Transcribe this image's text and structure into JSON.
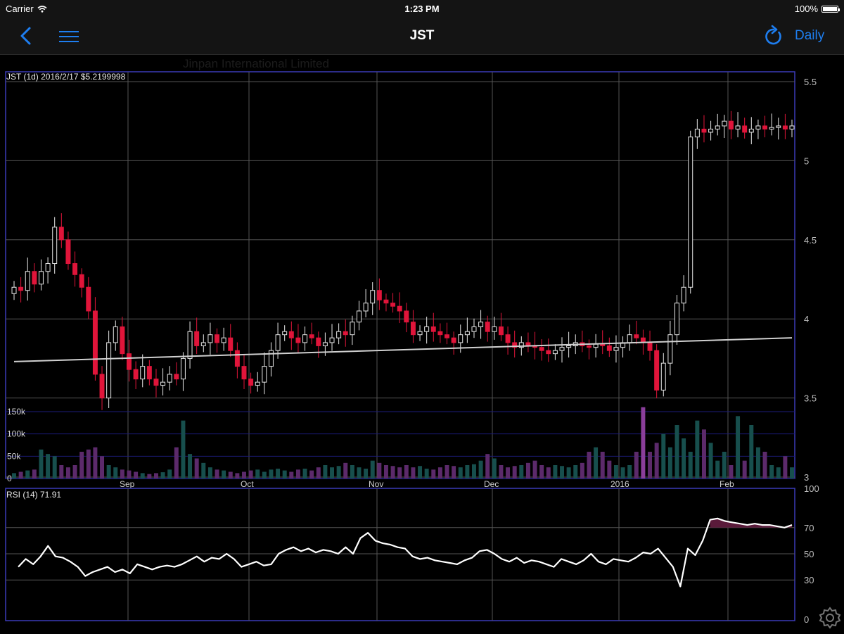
{
  "status_bar": {
    "carrier": "Carrier",
    "time": "1:23 PM",
    "battery": "100%"
  },
  "nav": {
    "title": "JST",
    "period_label": "Daily",
    "icons": {
      "back": "chevron-left-icon",
      "menu": "hamburger-menu-icon",
      "refresh": "refresh-icon",
      "settings": "gear-icon"
    },
    "accent_color": "#1e7ef0"
  },
  "chart_data": [
    {
      "type": "candlestick",
      "watermark": "Jinpan International Limited",
      "info_label": "JST (1d) 2016/2/17 $5.2199998",
      "ylim": [
        3,
        5.5
      ],
      "yticks": [
        "3",
        "3.5",
        "4",
        "4.5",
        "5",
        "5.5"
      ],
      "x_tick_labels": [
        "Sep",
        "Oct",
        "Nov",
        "Dec",
        "2016",
        "Feb"
      ],
      "colors": {
        "up": "#e8e8e8",
        "down": "#e0153a",
        "grid": "#555555",
        "axis": "#3a3ab8",
        "moving_average": "#d0d0d0"
      },
      "moving_average": [
        3.73,
        3.88
      ],
      "closes": [
        4.2,
        4.18,
        4.3,
        4.22,
        4.3,
        4.35,
        4.58,
        4.5,
        4.35,
        4.28,
        4.2,
        4.05,
        3.65,
        3.5,
        3.85,
        3.95,
        3.78,
        3.68,
        3.62,
        3.7,
        3.62,
        3.58,
        3.6,
        3.65,
        3.62,
        3.75,
        3.92,
        3.83,
        3.85,
        3.9,
        3.85,
        3.88,
        3.8,
        3.7,
        3.62,
        3.58,
        3.6,
        3.7,
        3.8,
        3.9,
        3.92,
        3.88,
        3.85,
        3.9,
        3.88,
        3.83,
        3.85,
        3.88,
        3.92,
        3.9,
        3.98,
        4.05,
        4.1,
        4.18,
        4.12,
        4.1,
        4.08,
        4.05,
        3.98,
        3.9,
        3.92,
        3.95,
        3.92,
        3.9,
        3.88,
        3.85,
        3.9,
        3.92,
        3.95,
        3.98,
        3.92,
        3.95,
        3.9,
        3.85,
        3.82,
        3.85,
        3.83,
        3.82,
        3.8,
        3.78,
        3.8,
        3.82,
        3.83,
        3.85,
        3.83,
        3.82,
        3.84,
        3.83,
        3.8,
        3.82,
        3.85,
        3.9,
        3.88,
        3.85,
        3.8,
        3.55,
        3.72,
        3.9,
        4.1,
        4.2,
        5.15,
        5.2,
        5.18,
        5.2,
        5.22,
        5.25,
        5.2,
        5.22,
        5.18,
        5.2,
        5.22,
        5.2,
        5.21,
        5.22,
        5.2,
        5.22
      ]
    },
    {
      "type": "bar",
      "title": "",
      "yticks": [
        "0",
        "50k",
        "100k",
        "150k"
      ],
      "ylim": [
        0,
        180000
      ],
      "colors": {
        "up": "#174f4d",
        "down": "#5c2a6b",
        "spike": "#8a3e9a"
      },
      "values": [
        12000,
        15000,
        18000,
        20000,
        65000,
        55000,
        50000,
        30000,
        25000,
        30000,
        60000,
        65000,
        70000,
        50000,
        30000,
        25000,
        20000,
        18000,
        15000,
        12000,
        10000,
        12000,
        14000,
        20000,
        70000,
        130000,
        55000,
        45000,
        35000,
        25000,
        20000,
        18000,
        15000,
        12000,
        15000,
        18000,
        20000,
        15000,
        20000,
        22000,
        18000,
        15000,
        20000,
        22000,
        18000,
        25000,
        30000,
        25000,
        28000,
        35000,
        30000,
        25000,
        22000,
        40000,
        35000,
        30000,
        28000,
        25000,
        30000,
        25000,
        28000,
        22000,
        20000,
        25000,
        30000,
        28000,
        25000,
        30000,
        32000,
        40000,
        55000,
        45000,
        30000,
        25000,
        28000,
        30000,
        35000,
        40000,
        30000,
        25000,
        30000,
        28000,
        25000,
        30000,
        35000,
        60000,
        70000,
        60000,
        40000,
        30000,
        25000,
        30000,
        60000,
        160000,
        60000,
        80000,
        100000,
        70000,
        120000,
        90000,
        60000,
        130000,
        110000,
        80000,
        40000,
        60000,
        30000,
        140000,
        40000,
        120000,
        70000,
        60000,
        30000,
        25000,
        50000,
        25000
      ]
    },
    {
      "type": "line",
      "label": "RSI (14) 71.91",
      "ylim": [
        0,
        100
      ],
      "yticks": [
        "0",
        "30",
        "50",
        "70",
        "100"
      ],
      "overbought_fill": "#5a1a3a",
      "values": [
        40,
        46,
        42,
        48,
        56,
        48,
        47,
        44,
        40,
        33,
        36,
        38,
        40,
        36,
        38,
        35,
        42,
        40,
        38,
        40,
        41,
        40,
        42,
        45,
        48,
        44,
        47,
        46,
        50,
        46,
        40,
        42,
        44,
        41,
        42,
        50,
        53,
        55,
        52,
        54,
        51,
        53,
        52,
        50,
        55,
        50,
        62,
        66,
        60,
        58,
        57,
        55,
        54,
        48,
        46,
        47,
        45,
        44,
        43,
        42,
        45,
        47,
        52,
        53,
        50,
        46,
        44,
        47,
        43,
        45,
        44,
        42,
        40,
        46,
        44,
        42,
        45,
        50,
        44,
        42,
        46,
        45,
        44,
        47,
        51,
        50,
        54,
        47,
        40,
        25,
        54,
        49,
        60,
        76,
        77,
        75,
        74,
        73,
        72,
        73,
        72,
        72,
        71,
        70,
        72
      ]
    }
  ]
}
